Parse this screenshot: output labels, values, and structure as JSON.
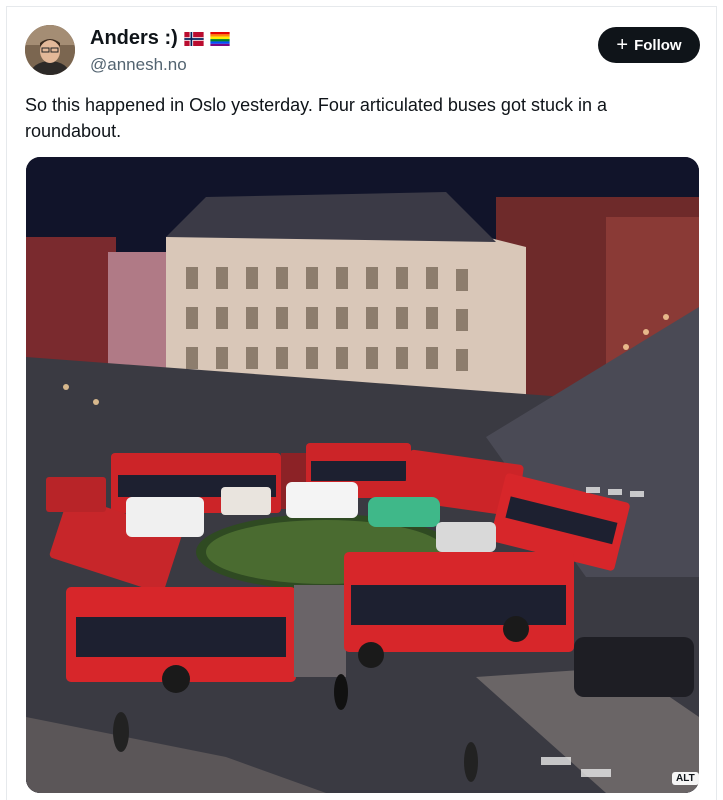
{
  "author": {
    "display_name": "Anders :)",
    "handle": "@annesh.no",
    "flags": [
      "norway-flag-icon",
      "rainbow-flag-icon"
    ]
  },
  "follow_button": {
    "label": "Follow",
    "icon": "plus-icon"
  },
  "post": {
    "text": "So this happened in Oslo yesterday. Four articulated buses got stuck in a roundabout."
  },
  "media": {
    "badge": "ALT"
  },
  "colors": {
    "follow_bg": "#0f1419",
    "handle": "#536471",
    "bus_red": "#d7262a"
  }
}
